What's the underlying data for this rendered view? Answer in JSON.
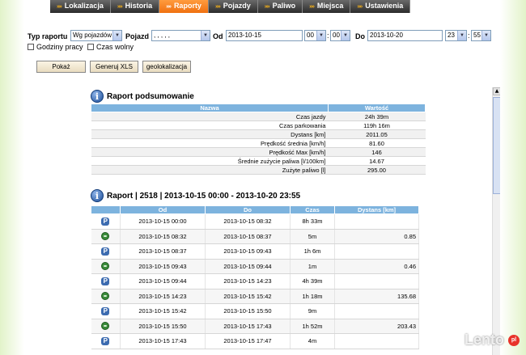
{
  "nav": {
    "tabs": [
      {
        "label": "Lokalizacja"
      },
      {
        "label": "Historia"
      },
      {
        "label": "Raporty",
        "active": true
      },
      {
        "label": "Pojazdy"
      },
      {
        "label": "Paliwo"
      },
      {
        "label": "Miejsca"
      },
      {
        "label": "Ustawienia"
      }
    ]
  },
  "filters": {
    "report_type_label": "Typ raportu",
    "report_type_value": "Wg pojazdów",
    "vehicle_label": "Pojazd",
    "vehicle_value": ", , , , ,",
    "from_label": "Od",
    "from_date": "2013-10-15",
    "from_hour": "00",
    "from_minute": "00",
    "to_label": "Do",
    "to_date": "2013-10-20",
    "to_hour": "23",
    "to_minute": "55",
    "working_hours_label": "Godziny pracy",
    "free_time_label": "Czas wolny"
  },
  "buttons": {
    "show": "Pokaż",
    "generate_xls": "Generuj XLS",
    "geolocation": "geolokalizacja"
  },
  "summary": {
    "title": "Raport podsumowanie",
    "headers": [
      "Nazwa",
      "Wartość"
    ],
    "rows": [
      {
        "name": "Czas jazdy",
        "value": "24h 39m"
      },
      {
        "name": "Czas parkowania",
        "value": "119h 16m"
      },
      {
        "name": "Dystans [km]",
        "value": "2011.05"
      },
      {
        "name": "Prędkość średnia [km/h]",
        "value": "81.60"
      },
      {
        "name": "Prędkość Max [km/h]",
        "value": "146"
      },
      {
        "name": "Średnie zużycie paliwa [l/100km]",
        "value": "14.67"
      },
      {
        "name": "Zużyte paliwo [l]",
        "value": "295.00"
      }
    ]
  },
  "trips": {
    "title": "Raport | 2518 | 2013-10-15 00:00 - 2013-10-20 23:55",
    "headers": [
      "",
      "Od",
      "Do",
      "Czas",
      "Dystans [km]"
    ],
    "rows": [
      {
        "icon": "parking-icon",
        "from": "2013-10-15 00:00",
        "to": "2013-10-15 08:32",
        "time": "8h 33m",
        "distance": ""
      },
      {
        "icon": "car-icon",
        "from": "2013-10-15 08:32",
        "to": "2013-10-15 08:37",
        "time": "5m",
        "distance": "0.85"
      },
      {
        "icon": "parking-icon",
        "from": "2013-10-15 08:37",
        "to": "2013-10-15 09:43",
        "time": "1h 6m",
        "distance": ""
      },
      {
        "icon": "car-icon",
        "from": "2013-10-15 09:43",
        "to": "2013-10-15 09:44",
        "time": "1m",
        "distance": "0.46"
      },
      {
        "icon": "parking-icon",
        "from": "2013-10-15 09:44",
        "to": "2013-10-15 14:23",
        "time": "4h 39m",
        "distance": ""
      },
      {
        "icon": "car-icon",
        "from": "2013-10-15 14:23",
        "to": "2013-10-15 15:42",
        "time": "1h 18m",
        "distance": "135.68"
      },
      {
        "icon": "parking-icon",
        "from": "2013-10-15 15:42",
        "to": "2013-10-15 15:50",
        "time": "9m",
        "distance": ""
      },
      {
        "icon": "car-icon",
        "from": "2013-10-15 15:50",
        "to": "2013-10-15 17:43",
        "time": "1h 52m",
        "distance": "203.43"
      },
      {
        "icon": "parking-icon",
        "from": "2013-10-15 17:43",
        "to": "2013-10-15 17:47",
        "time": "4m",
        "distance": ""
      }
    ]
  },
  "watermark": {
    "text": "Lento",
    "badge": "pl"
  },
  "colors": {
    "active_tab": "#f07010",
    "header_blue": "#7db3de",
    "side_green": "#e2f3c9"
  }
}
